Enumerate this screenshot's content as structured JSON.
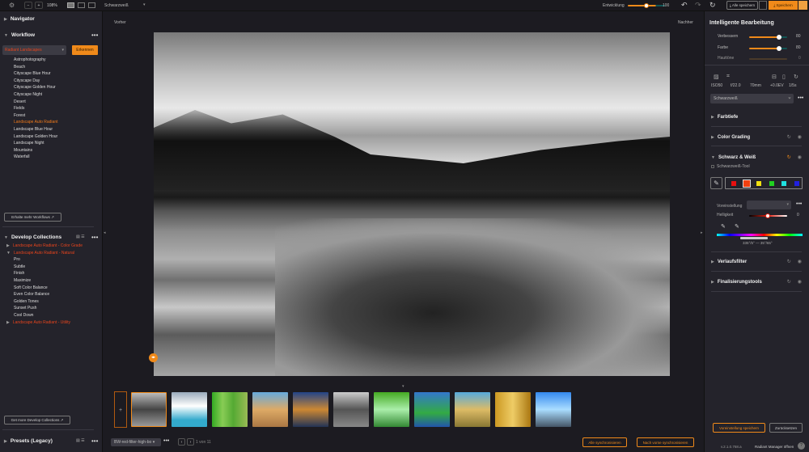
{
  "toolbar": {
    "zoom": "108%",
    "preset": "Schwarzweiß",
    "development_label": "Entwicklung",
    "development_value": "100",
    "development_fraction": 1.0,
    "save_all": "Alle speichern",
    "save": "Speichern"
  },
  "view": {
    "before": "Vorher",
    "after": "Nachher"
  },
  "left": {
    "navigator": "Navigator",
    "workflow": {
      "title": "Workflow",
      "select": "Radiant Landscapes",
      "detect": "Erkennen",
      "items": [
        "Astrophotography",
        "Beach",
        "Cityscape Blue Hour",
        "Cityscape Day",
        "Cityscape Golden Hour",
        "Cityscape Night",
        "Desert",
        "Fields",
        "Forest",
        "Landscape Auto Radiant",
        "Landscape Blue Hour",
        "Landscape Golden Hour",
        "Landscape Night",
        "Mountains",
        "Waterfall"
      ],
      "active_index": 9,
      "more": "Erhalte mehr Workflows"
    },
    "collections": {
      "title": "Develop Collections",
      "groups": [
        "Landscape Auto Radiant - Color Grade",
        "Landscape Auto Radiant - Natural",
        "Landscape Auto Radiant - Utility"
      ],
      "items": [
        "Pro",
        "Subtle",
        "Finish",
        "Maximize",
        "Soft Color Balance",
        "Even Color Balance",
        "Golden Tones",
        "Sunset Push",
        "Cool Down"
      ],
      "more": "Get more Develop Collections"
    },
    "presets": "Presets (Legacy)"
  },
  "bottom": {
    "preset_name": "BW-red-filter-high-bo",
    "page": "1 von 11",
    "sync_all": "Alle synchronisieren",
    "sync_prev": "Nach vorne synchronisieren"
  },
  "right": {
    "title": "Intelligente Bearbeitung",
    "sliders": [
      {
        "label": "Verbessern",
        "value": "80"
      },
      {
        "label": "Farbe",
        "value": "80"
      },
      {
        "label": "Hauttöne",
        "value": "0"
      }
    ],
    "exif": [
      "ISO50",
      "f/22.0",
      "70mm",
      "+0.0EV",
      "1/5s"
    ],
    "look": "Schwarzweiß",
    "sections": {
      "farbtiefe": "Farbtiefe",
      "color_grading": "Color Grading",
      "bw": "Schwarz & Weiß",
      "bw_tool": "Schwarzweiß-Tool",
      "preset_label": "Voreinstellung",
      "brightness_label": "Helligkeit",
      "brightness_value": "0",
      "range": "335°/5° — 35°/65°",
      "verlauf": "Verlaufsfilter",
      "final": "Finalisierungstools"
    },
    "swatches": [
      "#e81010",
      "#f04010",
      "#f0e010",
      "#20d020",
      "#20e0e0",
      "#2020e0"
    ],
    "save_preset": "Voreinstellung speichern",
    "reset": "Zurücksetzen",
    "version": "v.2.1.0.768.a",
    "manager": "Radiant Manager öffnen"
  }
}
